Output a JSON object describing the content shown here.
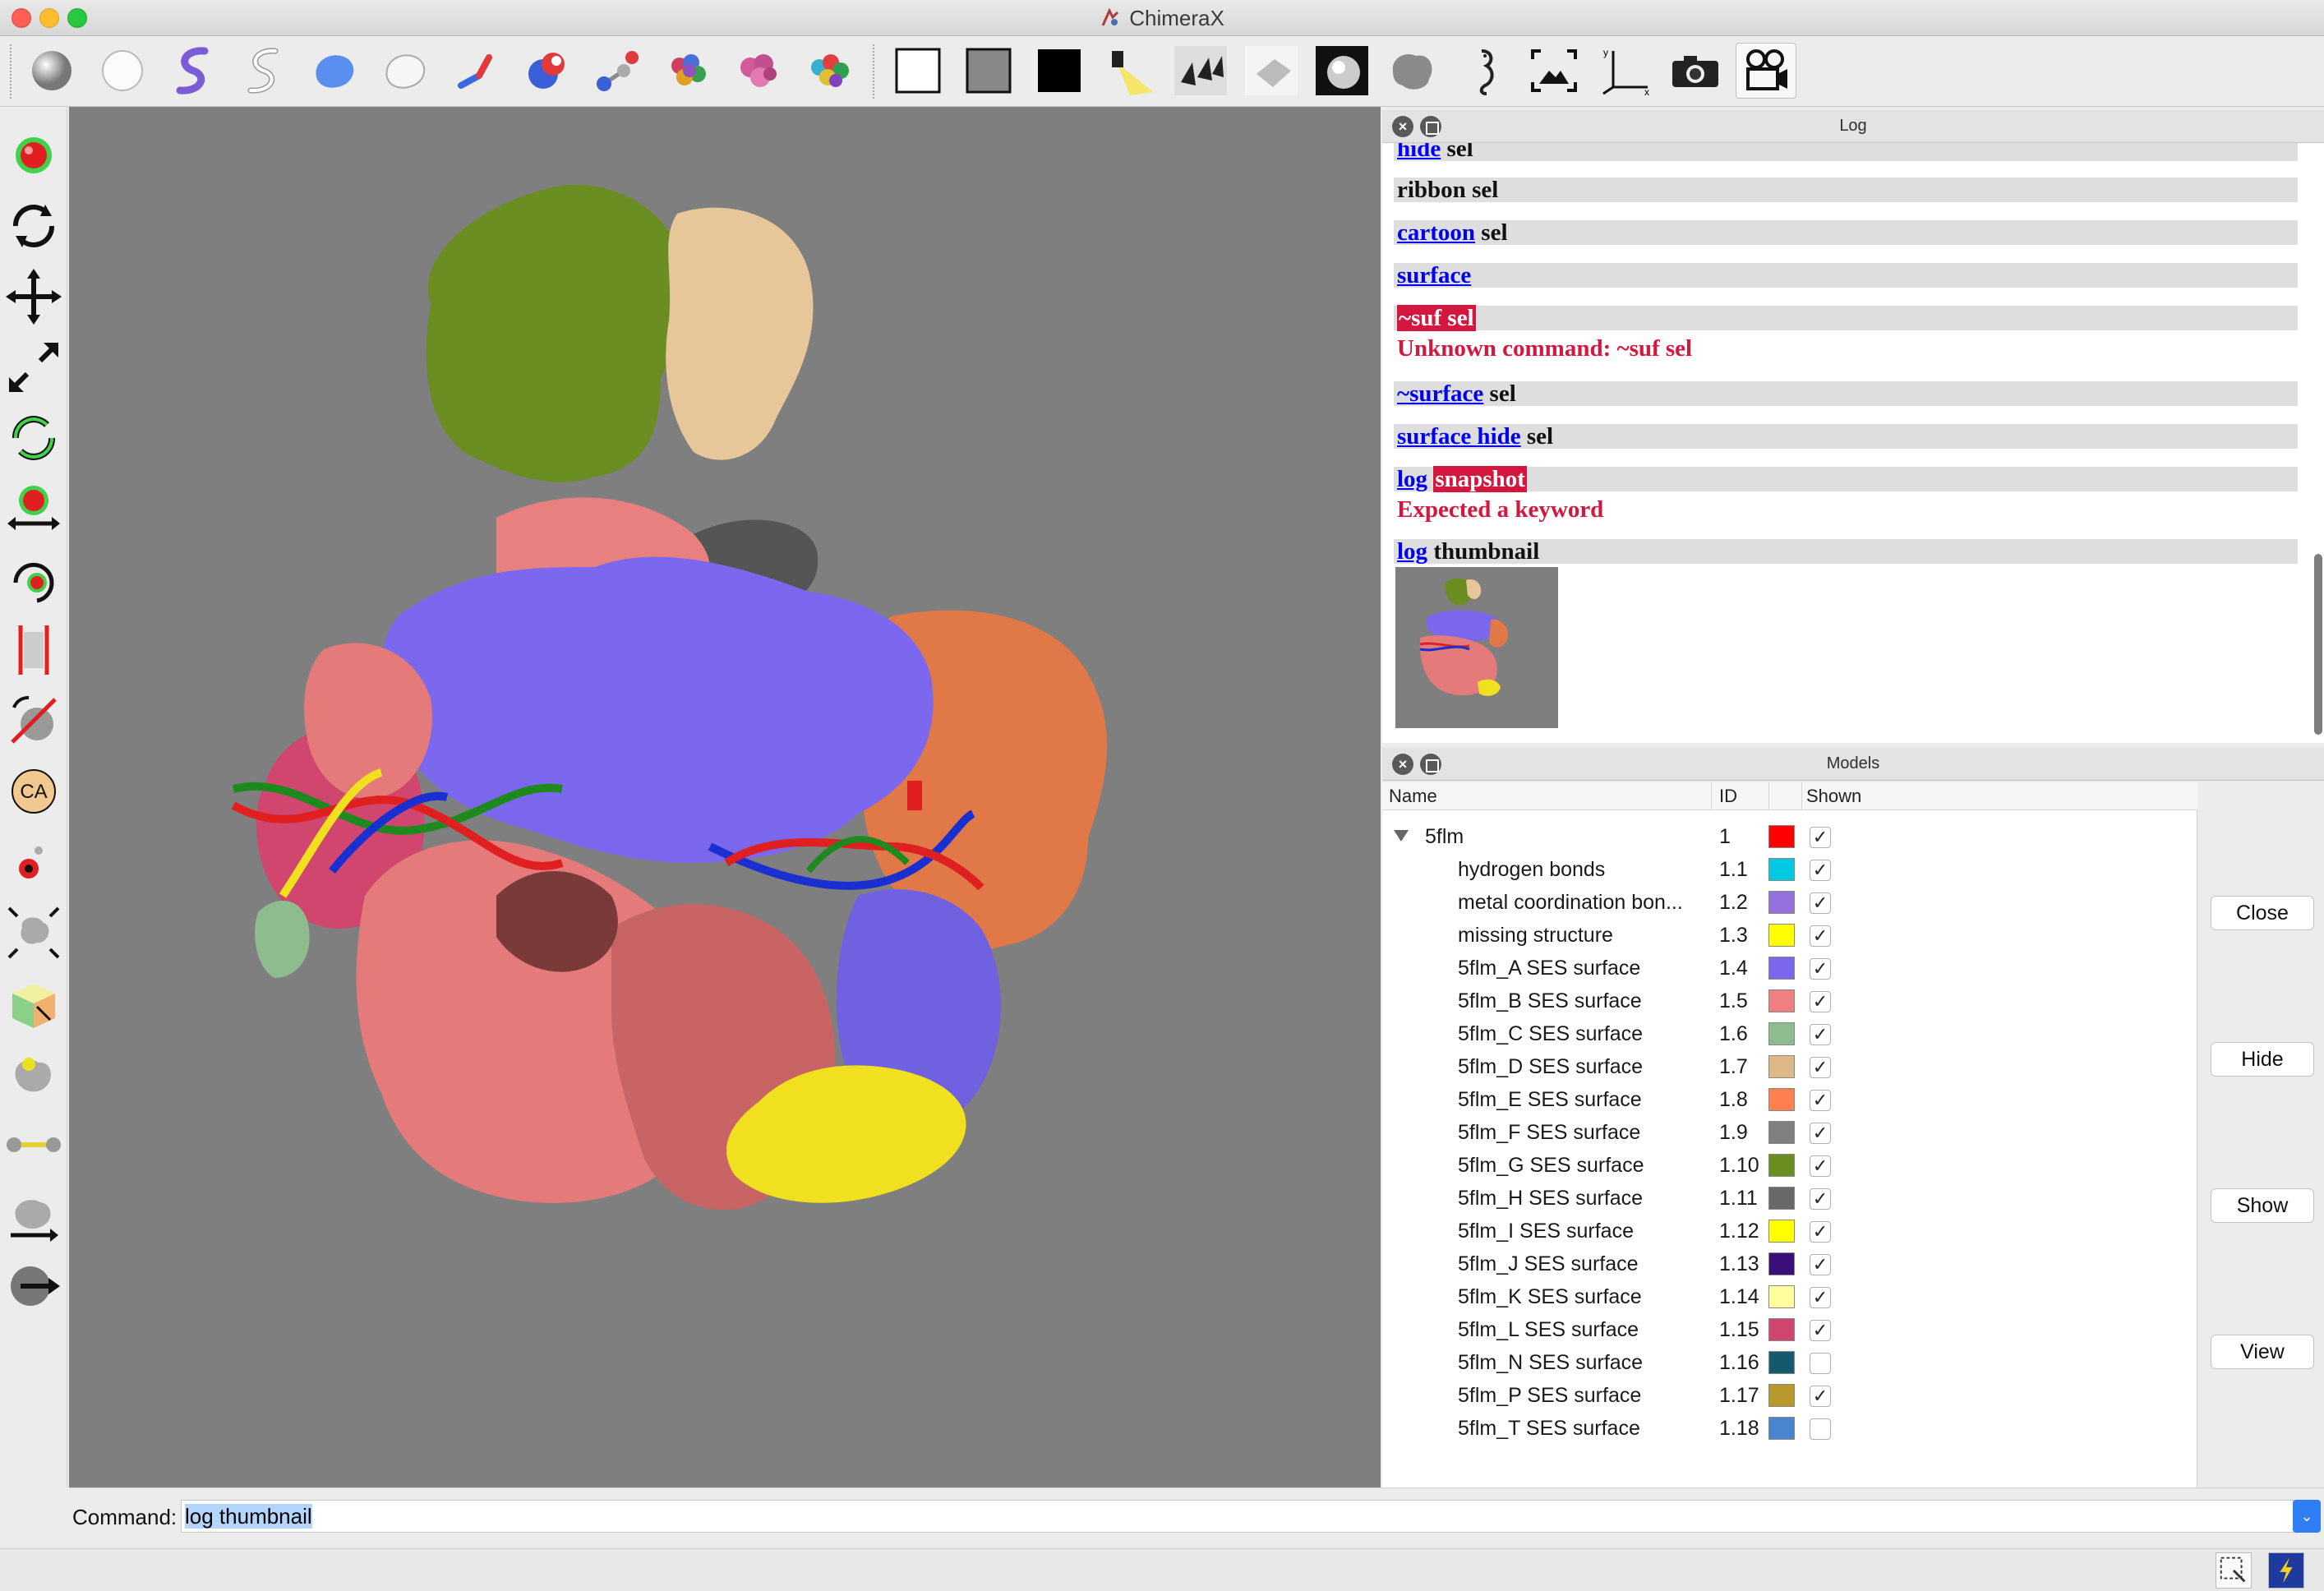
{
  "window": {
    "title": "ChimeraX"
  },
  "toolbar": {
    "buttons": [
      "ball-icon",
      "sphere-outline-icon",
      "ribbon-purple-icon",
      "ribbon-outline-icon",
      "surface-blob-icon",
      "surface-outline-icon",
      "stick-icon",
      "atom-sphere-icon",
      "ball-stick-icon",
      "spacefill-multicolor-icon",
      "spacefill-pink-icon",
      "spacefill-rainbow-icon",
      "background-white-icon",
      "background-gray-icon",
      "background-black-icon",
      "spotlight-icon",
      "shadows-icon",
      "soft-light-icon",
      "full-lighting-icon",
      "flat-blob-icon",
      "seahorse-icon",
      "view-all-icon",
      "axes-icon",
      "camera-icon",
      "movie-camera-icon"
    ]
  },
  "lefttools": {
    "buttons": [
      "select-atom-icon",
      "rotate-icon",
      "translate-icon",
      "zoom-icon",
      "rotate-green-icon",
      "move-atom-icon",
      "rotate-atom-icon",
      "clip-icon",
      "no-rotate-icon",
      "ca-label-icon",
      "pivot-icon",
      "move-pieces-icon",
      "cube-pick-icon",
      "blob-pick-icon",
      "distance-icon",
      "map-move-icon",
      "next-icon"
    ],
    "ca_label": "CA"
  },
  "log": {
    "title": "Log",
    "entries": [
      {
        "link": "hide",
        "rest": " sel"
      },
      {
        "plain": "ribbon sel"
      },
      {
        "link": "cartoon",
        "rest": " sel"
      },
      {
        "link": "surface",
        "rest": ""
      },
      {
        "error": "~suf sel",
        "message": "Unknown command: ~suf sel"
      },
      {
        "link": "~surface",
        "rest": " sel"
      },
      {
        "link": "surface hide",
        "rest": " sel"
      },
      {
        "link": "log",
        "error": "snapshot",
        "message": "Expected a keyword"
      },
      {
        "link": "log",
        "rest": " thumbnail"
      }
    ]
  },
  "models": {
    "title": "Models",
    "columns": {
      "name": "Name",
      "id": "ID",
      "shown": "Shown"
    },
    "rows": [
      {
        "name": "5flm",
        "id": "1",
        "color": "#ff0000",
        "shown": true,
        "top": true
      },
      {
        "name": "hydrogen bonds",
        "id": "1.1",
        "color": "#00c8e0",
        "shown": true
      },
      {
        "name": "metal coordination bon...",
        "id": "1.2",
        "color": "#9370db",
        "shown": true
      },
      {
        "name": "missing structure",
        "id": "1.3",
        "color": "#ffff00",
        "shown": true
      },
      {
        "name": "5flm_A SES surface",
        "id": "1.4",
        "color": "#7b68ee",
        "shown": true
      },
      {
        "name": "5flm_B SES surface",
        "id": "1.5",
        "color": "#f08080",
        "shown": true
      },
      {
        "name": "5flm_C SES surface",
        "id": "1.6",
        "color": "#8fbc8f",
        "shown": true
      },
      {
        "name": "5flm_D SES surface",
        "id": "1.7",
        "color": "#deb887",
        "shown": true
      },
      {
        "name": "5flm_E SES surface",
        "id": "1.8",
        "color": "#ff7f50",
        "shown": true
      },
      {
        "name": "5flm_F SES surface",
        "id": "1.9",
        "color": "#808080",
        "shown": true
      },
      {
        "name": "5flm_G SES surface",
        "id": "1.10",
        "color": "#6b8e23",
        "shown": true
      },
      {
        "name": "5flm_H SES surface",
        "id": "1.11",
        "color": "#696969",
        "shown": true
      },
      {
        "name": "5flm_I SES surface",
        "id": "1.12",
        "color": "#ffff00",
        "shown": true
      },
      {
        "name": "5flm_J SES surface",
        "id": "1.13",
        "color": "#3a1078",
        "shown": true
      },
      {
        "name": "5flm_K SES surface",
        "id": "1.14",
        "color": "#ffffa0",
        "shown": true
      },
      {
        "name": "5flm_L SES surface",
        "id": "1.15",
        "color": "#d0466e",
        "shown": true
      },
      {
        "name": "5flm_N SES surface",
        "id": "1.16",
        "color": "#145a6e",
        "shown": false
      },
      {
        "name": "5flm_P SES surface",
        "id": "1.17",
        "color": "#b8982a",
        "shown": true
      },
      {
        "name": "5flm_T SES surface",
        "id": "1.18",
        "color": "#4a86d0",
        "shown": false
      }
    ],
    "actions": {
      "close": "Close",
      "hide": "Hide",
      "show": "Show",
      "view": "View"
    }
  },
  "command": {
    "label": "Command:",
    "value": "log thumbnail"
  }
}
